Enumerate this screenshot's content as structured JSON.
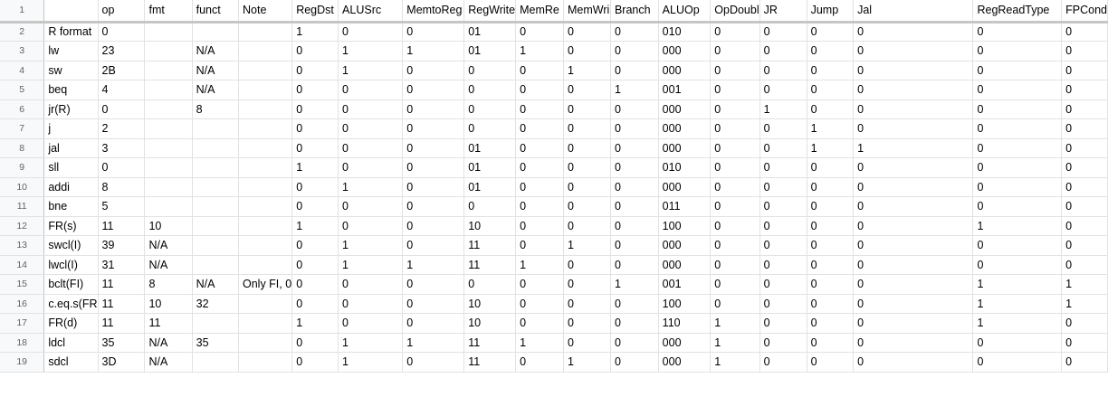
{
  "columns": [
    "",
    "op",
    "fmt",
    "funct",
    "Note",
    "RegDst",
    "ALUSrc",
    "MemtoReg",
    "RegWrite",
    "MemRe",
    "MemWri",
    "Branch",
    "ALUOp",
    "OpDoubl",
    "JR",
    "Jump",
    "Jal",
    "RegReadType",
    "FPCond"
  ],
  "row_numbers": [
    "1",
    "2",
    "3",
    "4",
    "5",
    "6",
    "7",
    "8",
    "9",
    "10",
    "11",
    "12",
    "13",
    "14",
    "15",
    "16",
    "17",
    "18",
    "19"
  ],
  "rows": [
    [
      "R format",
      "0",
      "",
      "",
      "",
      "1",
      "0",
      "0",
      "01",
      "0",
      "0",
      "0",
      "010",
      "0",
      "0",
      "0",
      "0",
      "0",
      "0"
    ],
    [
      "lw",
      "23",
      "",
      "N/A",
      "",
      "0",
      "1",
      "1",
      "01",
      "1",
      "0",
      "0",
      "000",
      "0",
      "0",
      "0",
      "0",
      "0",
      "0"
    ],
    [
      "sw",
      "2B",
      "",
      "N/A",
      "",
      "0",
      "1",
      "0",
      "0",
      "0",
      "1",
      "0",
      "000",
      "0",
      "0",
      "0",
      "0",
      "0",
      "0"
    ],
    [
      "beq",
      "4",
      "",
      "N/A",
      "",
      "0",
      "0",
      "0",
      "0",
      "0",
      "0",
      "1",
      "001",
      "0",
      "0",
      "0",
      "0",
      "0",
      "0"
    ],
    [
      "jr(R)",
      "0",
      "",
      "8",
      "",
      "0",
      "0",
      "0",
      "0",
      "0",
      "0",
      "0",
      "000",
      "0",
      "1",
      "0",
      "0",
      "0",
      "0"
    ],
    [
      "j",
      "2",
      "",
      "",
      "",
      "0",
      "0",
      "0",
      "0",
      "0",
      "0",
      "0",
      "000",
      "0",
      "0",
      "1",
      "0",
      "0",
      "0"
    ],
    [
      "jal",
      "3",
      "",
      "",
      "",
      "0",
      "0",
      "0",
      "01",
      "0",
      "0",
      "0",
      "000",
      "0",
      "0",
      "1",
      "1",
      "0",
      "0"
    ],
    [
      "sll",
      "0",
      "",
      "",
      "",
      "1",
      "0",
      "0",
      "01",
      "0",
      "0",
      "0",
      "010",
      "0",
      "0",
      "0",
      "0",
      "0",
      "0"
    ],
    [
      "addi",
      "8",
      "",
      "",
      "",
      "0",
      "1",
      "0",
      "01",
      "0",
      "0",
      "0",
      "000",
      "0",
      "0",
      "0",
      "0",
      "0",
      "0"
    ],
    [
      "bne",
      "5",
      "",
      "",
      "",
      "0",
      "0",
      "0",
      "0",
      "0",
      "0",
      "0",
      "011",
      "0",
      "0",
      "0",
      "0",
      "0",
      "0"
    ],
    [
      "FR(s)",
      "11",
      "10",
      "",
      "",
      "1",
      "0",
      "0",
      "10",
      "0",
      "0",
      "0",
      "100",
      "0",
      "0",
      "0",
      "0",
      "1",
      "0"
    ],
    [
      "swcl(I)",
      "39",
      "N/A",
      "",
      "",
      "0",
      "1",
      "0",
      "11",
      "0",
      "1",
      "0",
      "000",
      "0",
      "0",
      "0",
      "0",
      "0",
      "0"
    ],
    [
      "lwcl(I)",
      "31",
      "N/A",
      "",
      "",
      "0",
      "1",
      "1",
      "11",
      "1",
      "0",
      "0",
      "000",
      "0",
      "0",
      "0",
      "0",
      "0",
      "0"
    ],
    [
      "bclt(FI)",
      "11",
      "8",
      "N/A",
      "Only FI, 0",
      "0",
      "0",
      "0",
      "0",
      "0",
      "0",
      "1",
      "001",
      "0",
      "0",
      "0",
      "0",
      "1",
      "1"
    ],
    [
      "c.eq.s(FR",
      "11",
      "10",
      "32",
      "",
      "0",
      "0",
      "0",
      "10",
      "0",
      "0",
      "0",
      "100",
      "0",
      "0",
      "0",
      "0",
      "1",
      "1"
    ],
    [
      "FR(d)",
      "11",
      "11",
      "",
      "",
      "1",
      "0",
      "0",
      "10",
      "0",
      "0",
      "0",
      "110",
      "1",
      "0",
      "0",
      "0",
      "1",
      "0"
    ],
    [
      "ldcl",
      "35",
      "N/A",
      "35",
      "",
      "0",
      "1",
      "1",
      "11",
      "1",
      "0",
      "0",
      "000",
      "1",
      "0",
      "0",
      "0",
      "0",
      "0"
    ],
    [
      "sdcl",
      "3D",
      "N/A",
      "",
      "",
      "0",
      "1",
      "0",
      "11",
      "0",
      "1",
      "0",
      "000",
      "1",
      "0",
      "0",
      "0",
      "0",
      "0"
    ]
  ]
}
